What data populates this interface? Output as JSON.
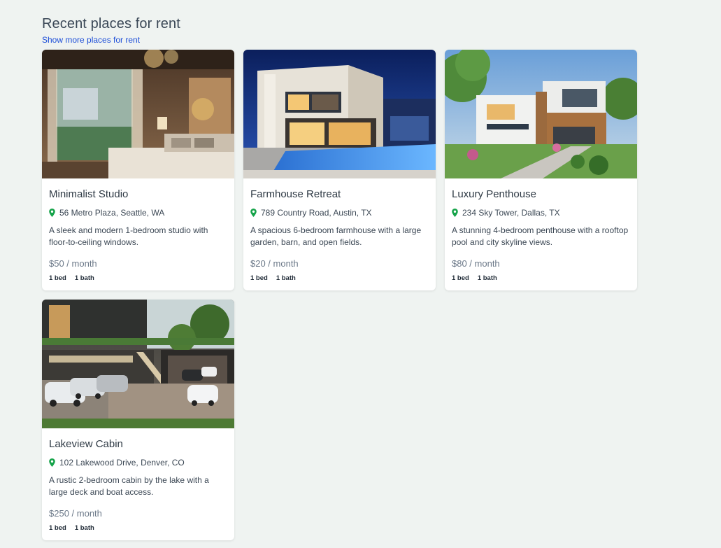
{
  "header": {
    "title": "Recent places for rent",
    "more_link": "Show more places for rent"
  },
  "listings": [
    {
      "name": "Minimalist Studio",
      "address": "56 Metro Plaza, Seattle, WA",
      "description": "A sleek and modern 1-bedroom studio with floor-to-ceiling windows.",
      "price": "$50 / month",
      "beds": "1 bed",
      "baths": "1 bath",
      "image": "bedroom-interior-photo"
    },
    {
      "name": "Farmhouse Retreat",
      "address": "789 Country Road, Austin, TX",
      "description": "A spacious 6-bedroom farmhouse with a large garden, barn, and open fields.",
      "price": "$20 / month",
      "beds": "1 bed",
      "baths": "1 bath",
      "image": "modern-villa-night-photo"
    },
    {
      "name": "Luxury Penthouse",
      "address": "234 Sky Tower, Dallas, TX",
      "description": "A stunning 4-bedroom penthouse with a rooftop pool and city skyline views.",
      "price": "$80 / month",
      "beds": "1 bed",
      "baths": "1 bath",
      "image": "modern-house-garden-photo"
    },
    {
      "name": "Lakeview Cabin",
      "address": "102 Lakewood Drive, Denver, CO",
      "description": "A rustic 2-bedroom cabin by the lake with a large deck and boat access.",
      "price": "$250 / month",
      "beds": "1 bed",
      "baths": "1 bath",
      "image": "luxury-driveway-cars-photo"
    }
  ],
  "colors": {
    "background": "#eff3f1",
    "link": "#1d4ed8",
    "pin": "#16a34a",
    "price": "#6b7888"
  },
  "icons": {
    "location": "map-pin-icon"
  }
}
